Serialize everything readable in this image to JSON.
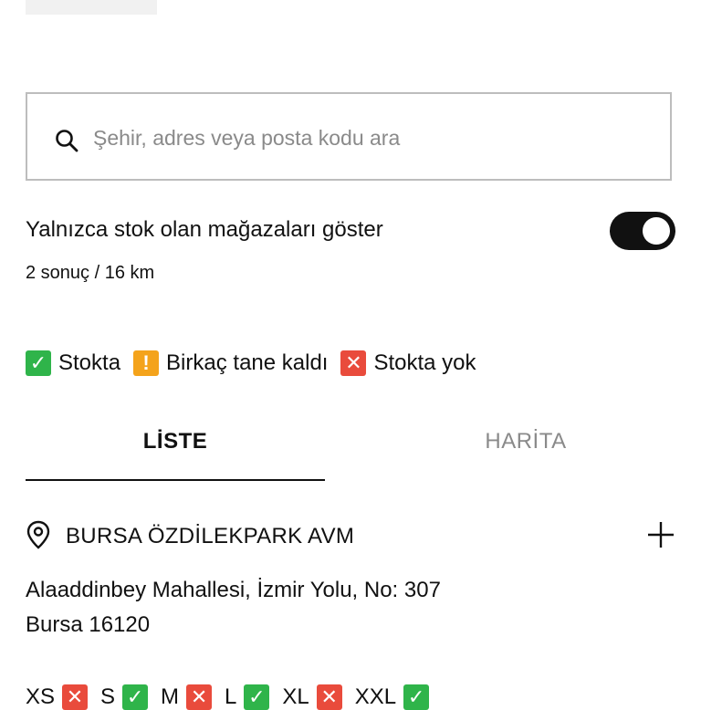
{
  "search": {
    "placeholder": "Şehir, adres veya posta kodu ara",
    "icon": "search-icon"
  },
  "filter": {
    "label": "Yalnızca stok olan mağazaları göster",
    "enabled": true
  },
  "results_text": "2 sonuç / 16 km",
  "legend": [
    {
      "label": "Stokta",
      "status": "in-stock",
      "color": "#2fb44a",
      "glyph": "✓"
    },
    {
      "label": "Birkaç tane kaldı",
      "status": "few-left",
      "color": "#f4a31b",
      "glyph": "!"
    },
    {
      "label": "Stokta yok",
      "status": "out-of-stock",
      "color": "#e94b3c",
      "glyph": "✕"
    }
  ],
  "tabs": {
    "list": "LİSTE",
    "map": "HARİTA",
    "active": "list"
  },
  "store": {
    "name": "BURSA ÖZDİLEKPARK AVM",
    "address_line1": "Alaaddinbey Mahallesi, İzmir Yolu, No: 307",
    "address_line2": "Bursa 16120",
    "sizes": [
      {
        "label": "XS",
        "status": "out-of-stock"
      },
      {
        "label": "S",
        "status": "in-stock"
      },
      {
        "label": "M",
        "status": "out-of-stock"
      },
      {
        "label": "L",
        "status": "in-stock"
      },
      {
        "label": "XL",
        "status": "out-of-stock"
      },
      {
        "label": "XXL",
        "status": "in-stock"
      }
    ]
  }
}
